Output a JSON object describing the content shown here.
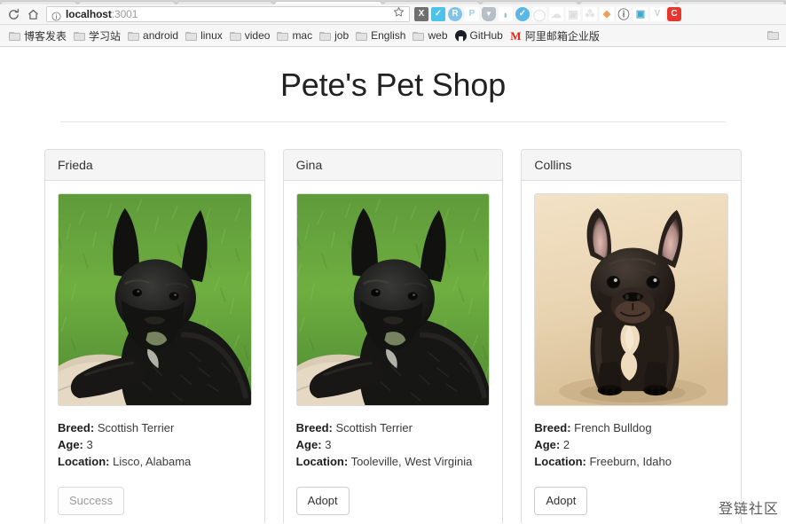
{
  "browser": {
    "nav": {
      "reload_label": "reload-page",
      "home_label": "home"
    },
    "omnibox": {
      "info_icon": "info-circle-icon",
      "url_host": "localhost",
      "url_port": ":3001",
      "url_full": "localhost:3001",
      "bookmark_icon": "star-icon"
    },
    "extensions": [
      {
        "name": "x-extension",
        "glyph": "X",
        "bg": "#6f6f6f",
        "fg": "#ffffff"
      },
      {
        "name": "checkmark-extension",
        "glyph": "✔",
        "bg": "#4ec3ea",
        "fg": "#ffffff"
      },
      {
        "name": "r-badge-extension",
        "glyph": "R",
        "bg": "#7ec4e8",
        "fg": "#ffffff"
      },
      {
        "name": "pocket-p-extension",
        "glyph": "P",
        "bg": "#ffffff",
        "fg": "#9ecdea"
      },
      {
        "name": "shield-extension",
        "glyph": "▼",
        "bg": "#b6bec6",
        "fg": "#ffffff"
      },
      {
        "name": "evernote-extension",
        "glyph": "◖",
        "bg": "#ffffff",
        "fg": "#9ec7d6"
      },
      {
        "name": "clock-circle-extension",
        "glyph": "✓",
        "bg": "#5bb7e5",
        "fg": "#ffffff"
      },
      {
        "name": "ring-extension",
        "glyph": "○",
        "bg": "#ffffff",
        "fg": "#e2e2e2"
      },
      {
        "name": "cloud-extension",
        "glyph": "☁",
        "bg": "#ffffff",
        "fg": "#e0e0e0"
      },
      {
        "name": "save-disk-extension",
        "glyph": "▣",
        "bg": "#ffffff",
        "fg": "#dedede"
      },
      {
        "name": "share-node-extension",
        "glyph": "⑂",
        "bg": "#ffffff",
        "fg": "#e0e0e0"
      },
      {
        "name": "fox-extension",
        "glyph": "◆",
        "bg": "#ffffff",
        "fg": "#e8a05a"
      },
      {
        "name": "info-extension",
        "glyph": "ⓘ",
        "bg": "#ffffff",
        "fg": "#6e6e6e"
      },
      {
        "name": "camera-extension",
        "glyph": "■",
        "bg": "#ffffff",
        "fg": "#3fa9d4"
      },
      {
        "name": "v-extension",
        "glyph": "V",
        "bg": "#ffffff",
        "fg": "#cfcfcf"
      },
      {
        "name": "c-extension",
        "glyph": "C",
        "bg": "#e8352e",
        "fg": "#ffffff"
      }
    ],
    "bookmarks": [
      {
        "label": "博客发表",
        "icon": "folder-icon"
      },
      {
        "label": "学习站",
        "icon": "folder-icon"
      },
      {
        "label": "android",
        "icon": "folder-icon"
      },
      {
        "label": "linux",
        "icon": "folder-icon"
      },
      {
        "label": "video",
        "icon": "folder-icon"
      },
      {
        "label": "mac",
        "icon": "folder-icon"
      },
      {
        "label": "job",
        "icon": "folder-icon"
      },
      {
        "label": "English",
        "icon": "folder-icon"
      },
      {
        "label": "web",
        "icon": "folder-icon"
      },
      {
        "label": "GitHub",
        "icon": "github-icon"
      },
      {
        "label": "阿里邮箱企业版",
        "icon": "mail-m-icon"
      }
    ],
    "bookmarks_overflow_icon": "folder-overflow-icon"
  },
  "page": {
    "title": "Pete's Pet Shop",
    "labels": {
      "breed": "Breed:",
      "age": "Age:",
      "location": "Location:"
    },
    "watermark": "登链社区",
    "pets": [
      {
        "name": "Frieda",
        "breed": "Scottish Terrier",
        "age": "3",
        "location": "Lisco, Alabama",
        "button_label": "Success",
        "button_state": "success-disabled",
        "photo": "scottish-terrier-on-grass"
      },
      {
        "name": "Gina",
        "breed": "Scottish Terrier",
        "age": "3",
        "location": "Tooleville, West Virginia",
        "button_label": "Adopt",
        "button_state": "default",
        "photo": "scottish-terrier-on-grass"
      },
      {
        "name": "Collins",
        "breed": "French Bulldog",
        "age": "2",
        "location": "Freeburn, Idaho",
        "button_label": "Adopt",
        "button_state": "default",
        "photo": "french-bulldog-on-beige"
      }
    ]
  }
}
